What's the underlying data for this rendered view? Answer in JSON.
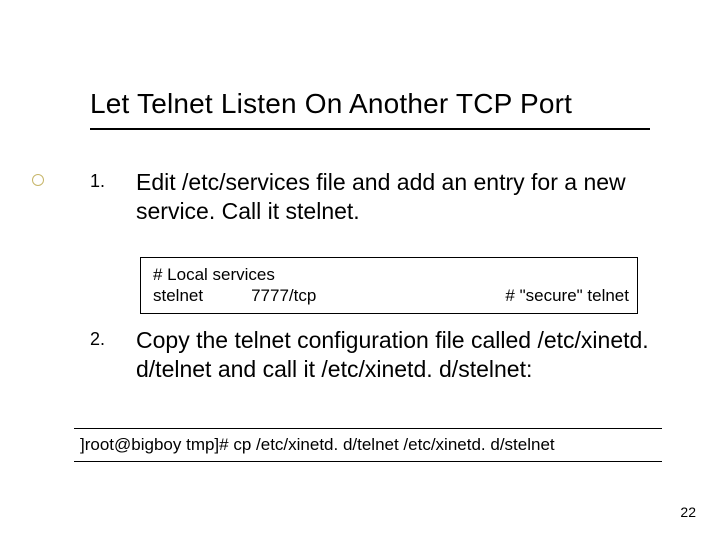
{
  "title": "Let Telnet Listen On Another TCP Port",
  "items": [
    {
      "num": "1.",
      "text": "Edit /etc/services file and add an entry for a new service. Call it stelnet."
    },
    {
      "num": "2.",
      "text": "Copy the telnet configuration file called /etc/xinetd. d/telnet and call it /etc/xinetd. d/stelnet:"
    }
  ],
  "code1": {
    "line1": "# Local services",
    "line2_left_a": "stelnet",
    "line2_left_b": "7777/tcp",
    "line2_right": "# \"secure\" telnet"
  },
  "code2": "]root@bigboy tmp]# cp /etc/xinetd. d/telnet /etc/xinetd. d/stelnet",
  "page_number": "22"
}
